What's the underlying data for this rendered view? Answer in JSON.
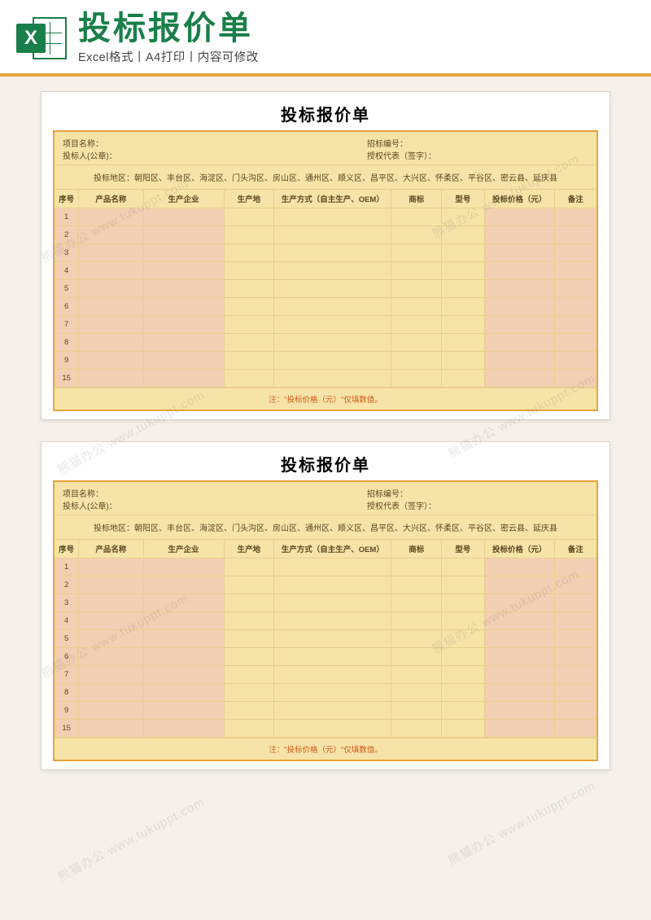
{
  "header": {
    "title": "投标报价单",
    "subtitle": "Excel格式丨A4打印丨内容可修改",
    "icon_letter": "X",
    "icon_name": "excel-icon"
  },
  "document": {
    "title": "投标报价单",
    "info": {
      "project_label": "项目名称：",
      "bidno_label": "招标编号：",
      "bidder_label": "投标人(公章)：",
      "rep_label": "授权代表（签字）："
    },
    "region_bar": "投标地区：朝阳区、丰台区、海淀区、门头沟区、房山区、通州区、顺义区、昌平区、大兴区、怀柔区、平谷区、密云县、延庆县",
    "columns": [
      "序号",
      "产品名称",
      "生产企业",
      "生产地",
      "生产方式（自主生产、OEM）",
      "商标",
      "型号",
      "投标价格（元）",
      "备注"
    ],
    "row_numbers": [
      1,
      2,
      3,
      4,
      5,
      6,
      7,
      8,
      9,
      15
    ],
    "column_tone": [
      "peach",
      "peach",
      "peach",
      "yellow",
      "yellow",
      "yellow",
      "yellow",
      "peach",
      "peach"
    ],
    "footnote": "注：\"投标价格（元）\"仅填数值。"
  },
  "watermark_text": "熊猫办公 www.tukuppt.com"
}
